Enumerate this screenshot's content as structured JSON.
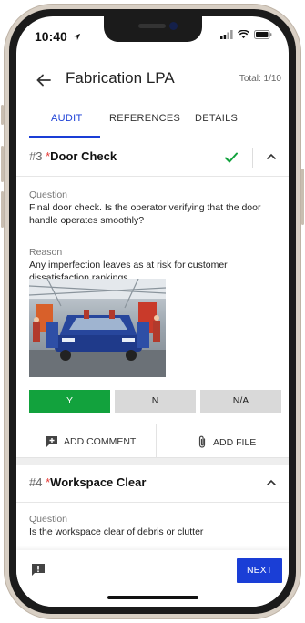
{
  "status_bar": {
    "time": "10:40"
  },
  "header": {
    "title": "Fabrication LPA",
    "total": "Total: 1/10"
  },
  "tabs": [
    {
      "label": "AUDIT",
      "active": true
    },
    {
      "label": "REFERENCES",
      "active": false
    },
    {
      "label": "DETAILS",
      "active": false
    }
  ],
  "question_3": {
    "number": "#3",
    "required_mark": "*",
    "title": "Door Check",
    "answered": true,
    "question_label": "Question",
    "question_text": "Final door check. Is the operator verifying that the door handle operates smoothly?",
    "reason_label": "Reason",
    "reason_text": "Any imperfection leaves as at risk for customer dissatisfaction rankings",
    "answers": {
      "yes": "Y",
      "no": "N",
      "na": "N/A",
      "selected": "Y"
    },
    "add_comment": "ADD COMMENT",
    "add_file": "ADD FILE"
  },
  "question_4": {
    "number": "#4",
    "required_mark": "*",
    "title": "Workspace Clear",
    "question_label": "Question",
    "question_text": "Is the workspace clear of debris or clutter"
  },
  "footer": {
    "next": "NEXT"
  },
  "colors": {
    "accent": "#1a3ed6",
    "success": "#12a23d",
    "required": "#e53935"
  }
}
